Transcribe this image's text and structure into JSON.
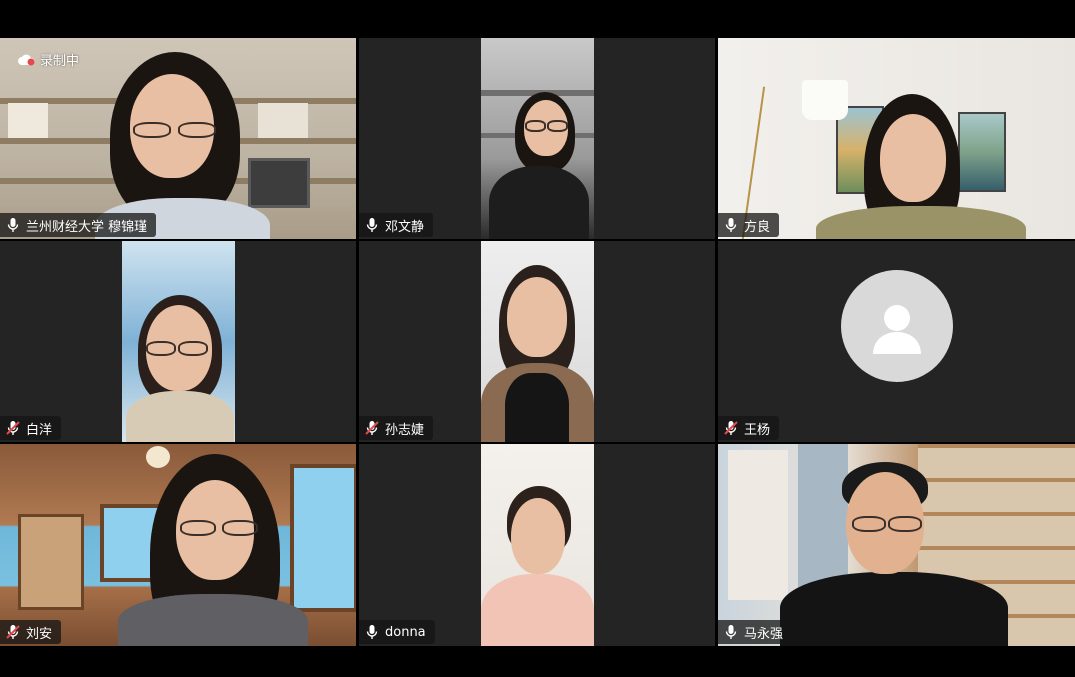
{
  "recording": {
    "label": "录制中"
  },
  "participants": [
    {
      "name": "兰州财经大学 穆锦瑾",
      "mic": "on",
      "active": true
    },
    {
      "name": "邓文静",
      "mic": "on"
    },
    {
      "name": "方良",
      "mic": "on"
    },
    {
      "name": "白洋",
      "mic": "muted"
    },
    {
      "name": "孙志婕",
      "mic": "muted"
    },
    {
      "name": "王杨",
      "mic": "muted"
    },
    {
      "name": "刘安",
      "mic": "muted"
    },
    {
      "name": "donna",
      "mic": "on"
    },
    {
      "name": "马永强",
      "mic": "on"
    }
  ],
  "colors": {
    "active_border": "#22c55e",
    "muted": "#e5484d",
    "tile_bg": "#242424"
  }
}
